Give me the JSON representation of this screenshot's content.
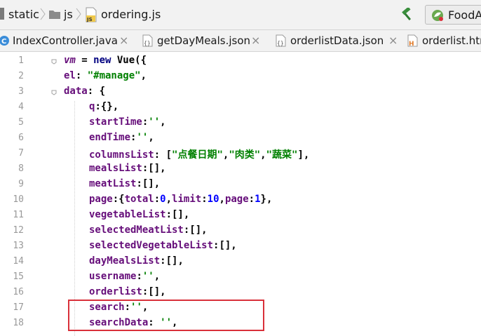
{
  "breadcrumb": {
    "items": [
      "static",
      "js",
      "ordering.js"
    ]
  },
  "run_config": {
    "label": "FoodA"
  },
  "tabs": [
    {
      "label": "IndexController.java",
      "icon": "java-class-icon",
      "close": "×"
    },
    {
      "label": "getDayMeals.json",
      "icon": "json-file-icon",
      "close": "×"
    },
    {
      "label": "orderlistData.json",
      "icon": "json-file-icon",
      "close": "×"
    },
    {
      "label": "orderlist.htm",
      "icon": "html-file-icon"
    }
  ],
  "editor": {
    "line_numbers": [
      "1",
      "2",
      "3",
      "4",
      "5",
      "6",
      "7",
      "8",
      "9",
      "10",
      "11",
      "12",
      "13",
      "14",
      "15",
      "16",
      "17",
      "18"
    ],
    "lines": [
      {
        "a": "vm",
        "b": " = ",
        "c": "new",
        "d": " Vue({"
      },
      {
        "a": "el",
        "b": ": ",
        "c": "\"#manage\"",
        "d": ","
      },
      {
        "a": "data",
        "b": ": {"
      },
      {
        "a": "q",
        "b": ":{},"
      },
      {
        "a": "startTime",
        "b": ":",
        "c": "''",
        "d": ","
      },
      {
        "a": "endTime",
        "b": ":",
        "c": "''",
        "d": ","
      },
      {
        "a": "columnsList",
        "b": ": [",
        "c": "\"点餐日期\"",
        "d": ",",
        "e": "\"肉类\"",
        "f": ",",
        "g": "\"蔬菜\"",
        "h": "],"
      },
      {
        "a": "mealsList",
        "b": ":[],"
      },
      {
        "a": "meatList",
        "b": ":[],"
      },
      {
        "a": "page",
        "b": ":{",
        "c": "total",
        "d": ":",
        "e": "0",
        "f": ",",
        "g": "limit",
        "h": ":",
        "i": "10",
        "j": ",",
        "k": "page",
        "l": ":",
        "m": "1",
        "n": "},"
      },
      {
        "a": "vegetableList",
        "b": ":[],"
      },
      {
        "a": "selectedMeatList",
        "b": ":[],"
      },
      {
        "a": "selectedVegetableList",
        "b": ":[],"
      },
      {
        "a": "dayMealsList",
        "b": ":[],"
      },
      {
        "a": "username",
        "b": ":",
        "c": "''",
        "d": ","
      },
      {
        "a": "orderlist",
        "b": ":[],"
      },
      {
        "a": "search",
        "b": ":",
        "c": "''",
        "d": ","
      },
      {
        "a": "searchData",
        "b": ": ",
        "c": "''",
        "d": ","
      }
    ]
  },
  "colors": {
    "highlight_box": "#d9303a",
    "property": "#660e7a",
    "string": "#008000",
    "number": "#0000ff",
    "keyword": "#000080"
  }
}
